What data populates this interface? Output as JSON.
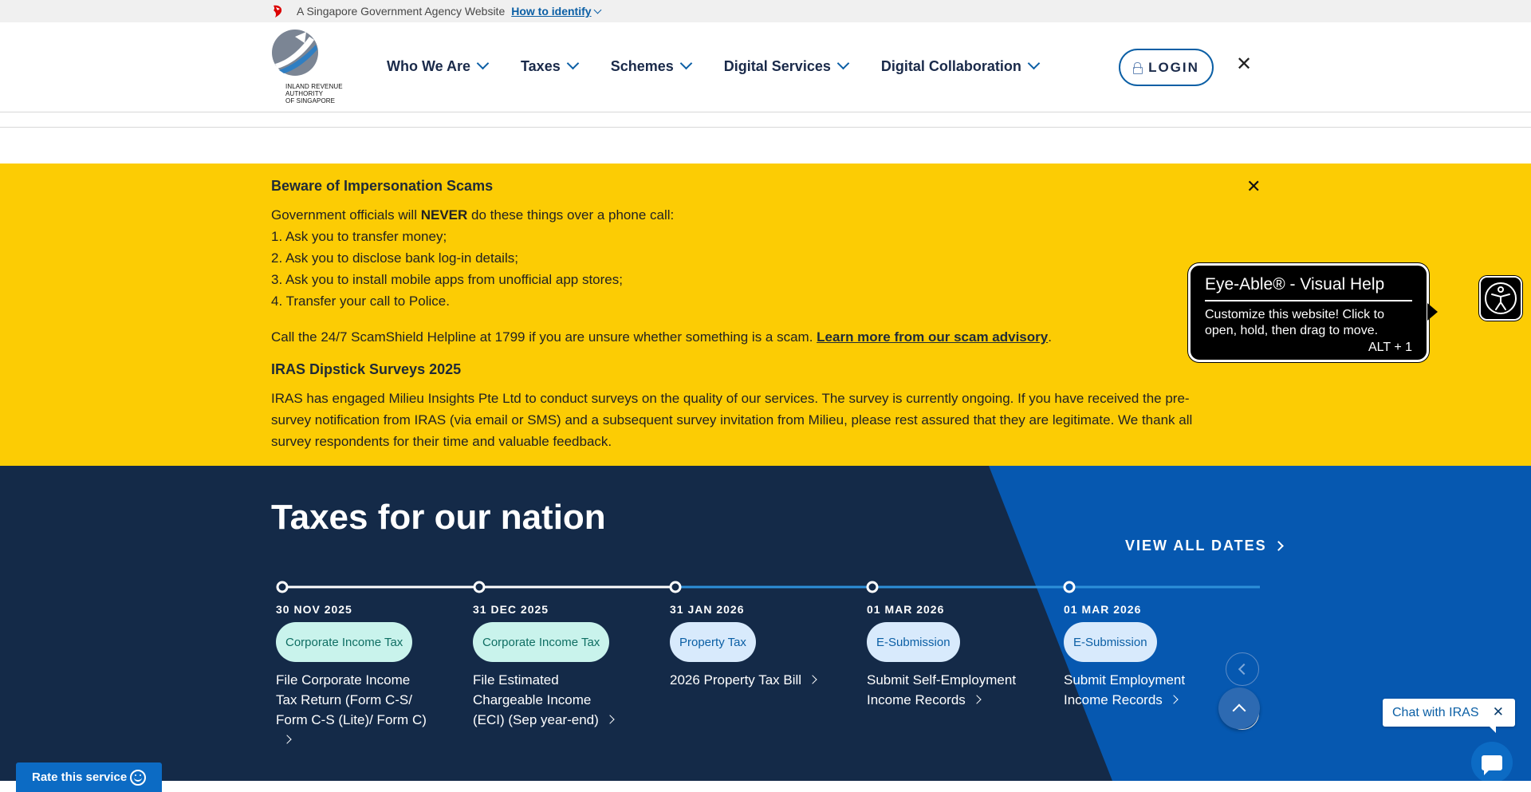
{
  "masthead": {
    "text": "A Singapore Government Agency Website",
    "link": "How to identify"
  },
  "header": {
    "logo_text": [
      "INLAND REVENUE",
      "AUTHORITY",
      "OF SINGAPORE"
    ],
    "nav": [
      "Who We Are",
      "Taxes",
      "Schemes",
      "Digital Services",
      "Digital Collaboration"
    ],
    "login_label": "LOGIN",
    "close_label": "✕"
  },
  "alert": {
    "title": "Beware of Impersonation Scams",
    "intro_pre": "Government officials will ",
    "intro_bold": "NEVER",
    "intro_post": " do these things over a phone call:",
    "items": [
      "1. Ask you to transfer money;",
      "2. Ask you to disclose bank log-in details;",
      "3. Ask you to install mobile apps from unofficial app stores;",
      "4. Transfer your call to Police."
    ],
    "helpline_pre": "Call the 24/7 ScamShield Helpline at 1799 if you are unsure whether something is a scam. ",
    "helpline_link": "Learn more from our scam advisory",
    "helpline_post": ".",
    "survey_title": "IRAS Dipstick Surveys 2025",
    "survey_text": "IRAS has engaged Milieu Insights Pte Ltd to conduct surveys on the quality of our services. The survey is currently ongoing. If you have received the pre-survey notification from IRAS (via email or SMS) and a subsequent survey invitation from Milieu, please rest assured that they are legitimate. We thank all survey respondents for their time and valuable feedback.",
    "close_label": "✕"
  },
  "eye_able": {
    "title": "Eye-Able® - Visual Help",
    "desc": "Customize this website! Click to open, hold, then drag to move.",
    "shortcut": "ALT + 1"
  },
  "taxes": {
    "title": "Taxes for our nation",
    "view_all": "VIEW ALL DATES",
    "dates": [
      {
        "date": "30 NOV 2025",
        "tag": "Corporate Income Tax",
        "tag_style": "teal",
        "desc": "File Corporate Income Tax Return (Form C-S/ Form C-S (Lite)/ Form C)"
      },
      {
        "date": "31 DEC 2025",
        "tag": "Corporate Income Tax",
        "tag_style": "teal",
        "desc": "File Estimated Chargeable Income (ECI) (Sep year-end)"
      },
      {
        "date": "31 JAN 2026",
        "tag": "Property Tax",
        "tag_style": "blue",
        "desc": "2026 Property Tax Bill"
      },
      {
        "date": "01 MAR 2026",
        "tag": "E-Submission",
        "tag_style": "blue",
        "desc": "Submit Self-Employment Income Records"
      },
      {
        "date": "01 MAR 2026",
        "tag": "E-Submission",
        "tag_style": "blue",
        "desc": "Submit Employment Income Records"
      }
    ]
  },
  "chat": {
    "label": "Chat with IRAS",
    "close": "✕"
  },
  "rate": {
    "label": "Rate this service"
  },
  "colors": {
    "alert_bg": "#fccc04",
    "navy": "#142a48",
    "blue": "#0b5fa5",
    "accent_blue": "#0c6bc4"
  }
}
